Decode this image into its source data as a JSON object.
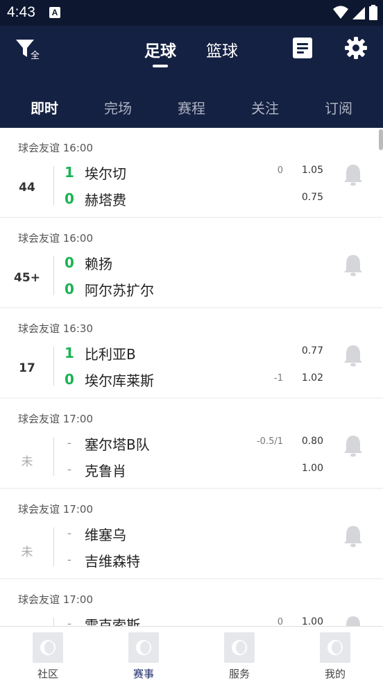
{
  "status": {
    "time": "4:43",
    "sim_label": "A"
  },
  "header": {
    "filter_label": "全",
    "sports": [
      {
        "label": "足球",
        "active": true
      },
      {
        "label": "篮球",
        "active": false
      }
    ]
  },
  "tabs": [
    {
      "label": "即时",
      "active": true
    },
    {
      "label": "完场",
      "active": false
    },
    {
      "label": "赛程",
      "active": false
    },
    {
      "label": "关注",
      "active": false
    },
    {
      "label": "订阅",
      "active": false
    }
  ],
  "matches": [
    {
      "league": "球会友谊 16:00",
      "minute": "44",
      "home": {
        "score": "1",
        "team": "埃尔切",
        "hcap": "0",
        "odds": "1.05"
      },
      "away": {
        "score": "0",
        "team": "赫塔费",
        "hcap": "",
        "odds": "0.75"
      }
    },
    {
      "league": "球会友谊 16:00",
      "minute": "45+",
      "home": {
        "score": "0",
        "team": "赖扬",
        "hcap": "",
        "odds": ""
      },
      "away": {
        "score": "0",
        "team": "阿尔苏扩尔",
        "hcap": "",
        "odds": ""
      }
    },
    {
      "league": "球会友谊 16:30",
      "minute": "17",
      "home": {
        "score": "1",
        "team": "比利亚B",
        "hcap": "",
        "odds": "0.77"
      },
      "away": {
        "score": "0",
        "team": "埃尔库莱斯",
        "hcap": "-1",
        "odds": "1.02"
      }
    },
    {
      "league": "球会友谊 17:00",
      "minute": "未",
      "home": {
        "score": "-",
        "team": "塞尔塔B队",
        "hcap": "-0.5/1",
        "odds": "0.80"
      },
      "away": {
        "score": "-",
        "team": "克鲁肖",
        "hcap": "",
        "odds": "1.00"
      }
    },
    {
      "league": "球会友谊 17:00",
      "minute": "未",
      "home": {
        "score": "-",
        "team": "维塞乌",
        "hcap": "",
        "odds": ""
      },
      "away": {
        "score": "-",
        "team": "吉维森特",
        "hcap": "",
        "odds": ""
      }
    },
    {
      "league": "球会友谊 17:00",
      "minute": "",
      "home": {
        "score": "-",
        "team": "雷克索斯",
        "hcap": "0",
        "odds": "1.00"
      },
      "away": {
        "score": "-",
        "team": "",
        "hcap": "",
        "odds": ""
      }
    }
  ],
  "bottom_nav": [
    {
      "label": "社区",
      "active": false
    },
    {
      "label": "赛事",
      "active": true
    },
    {
      "label": "服务",
      "active": false
    },
    {
      "label": "我的",
      "active": false
    }
  ],
  "colors": {
    "header_bg": "#152142",
    "statusbar_bg": "#0d1730",
    "score_green": "#1bb354",
    "active_nav": "#1c2a6b"
  }
}
